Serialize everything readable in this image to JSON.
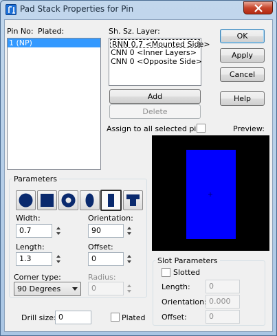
{
  "window": {
    "title": "Pad Stack Properties for Pin"
  },
  "pins": {
    "col_pin_no": "Pin No:",
    "col_plated": "Plated:",
    "items": [
      "1 (NP)"
    ]
  },
  "layers": {
    "header": "Sh. Sz. Layer:",
    "items": [
      "RNN 0.7 <Mounted Side>",
      "CNN 0 <Inner Layers>",
      "CNN 0 <Opposite Side>"
    ]
  },
  "buttons": {
    "ok": "OK",
    "apply": "Apply",
    "cancel": "Cancel",
    "help": "Help",
    "add": "Add",
    "delete": "Delete"
  },
  "assign_all": {
    "label": "Assign to all selected pins",
    "checked": false
  },
  "preview": {
    "label": "Preview:",
    "background": "#000000",
    "shape_color": "#0000ff"
  },
  "parameters": {
    "title": "Parameters",
    "shapes": [
      "round-shape-icon",
      "square-shape-icon",
      "annular-shape-icon",
      "oval-shape-icon",
      "rectangle-shape-icon",
      "custom-shape-icon"
    ],
    "selected_shape": "rectangle-shape-icon",
    "width": {
      "label": "Width:",
      "value": "0.7"
    },
    "orientation": {
      "label": "Orientation:",
      "value": "90"
    },
    "length": {
      "label": "Length:",
      "value": "1.3"
    },
    "offset": {
      "label": "Offset:",
      "value": "0"
    },
    "corner_type": {
      "label": "Corner type:",
      "value": "90 Degrees"
    },
    "radius": {
      "label": "Radius:",
      "value": "0"
    }
  },
  "slot": {
    "title": "Slot Parameters",
    "slotted": {
      "label": "Slotted",
      "checked": false
    },
    "length": {
      "label": "Length:",
      "value": "0"
    },
    "orientation": {
      "label": "Orientation:",
      "value": "0.000"
    },
    "offset": {
      "label": "Offset:",
      "value": "0"
    }
  },
  "drill": {
    "label": "Drill size:",
    "value": "0"
  },
  "plated": {
    "label": "Plated",
    "checked": false
  }
}
